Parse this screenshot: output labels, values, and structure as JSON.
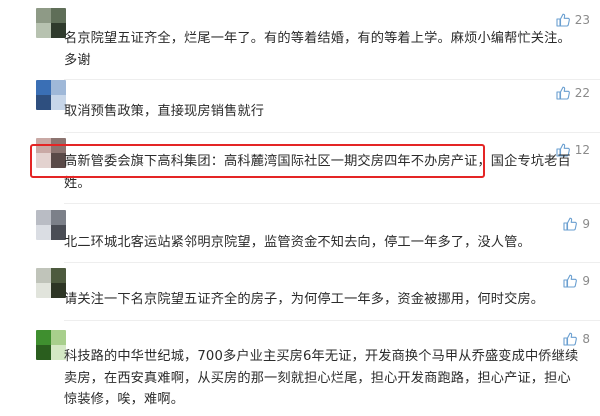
{
  "comments": [
    {
      "likes": "23",
      "text": "名京院望五证齐全，烂尾一年了。有的等着结婚，有的等着上学。麻烦小编帮忙关注。多谢",
      "avatar_colors": [
        "#8e9a86",
        "#5f6e58",
        "#b7c2b0",
        "#2f3a2c"
      ]
    },
    {
      "likes": "22",
      "text": "取消预售政策，直接现房销售就行",
      "avatar_colors": [
        "#3a6fb5",
        "#9fb8d8",
        "#2e4f7f",
        "#c7d6e9"
      ]
    },
    {
      "likes": "12",
      "text": "高新管委会旗下高科集团：高科麓湾国际社区一期交房四年不办房产证，国企专坑老百姓。",
      "avatar_colors": [
        "#c9a9a5",
        "#8c7470",
        "#e3d2cf",
        "#5a4a48"
      ]
    },
    {
      "likes": "9",
      "text": "北二环城北客运站紧邻明京院望，监管资金不知去向，停工一年多了，没人管。",
      "avatar_colors": [
        "#b9bcc4",
        "#7c8089",
        "#dadde3",
        "#4a4d55"
      ]
    },
    {
      "likes": "9",
      "text": "请关注一下名京院望五证齐全的房子，为何停工一年多，资金被挪用，何时交房。",
      "avatar_colors": [
        "#c0c4ba",
        "#4d5a3e",
        "#e1e4dc",
        "#2d3524"
      ]
    },
    {
      "likes": "8",
      "text": "科技路的中华世纪城，700多户业主买房6年无证，开发商换个马甲从乔盛变成中侨继续卖房，在西安真难啊，从买房的那一刻就担心烂尾，担心开发商跑路，担心产证，担心惊装修，唉，难啊。",
      "avatar_colors": [
        "#3f8f2f",
        "#a8cf8c",
        "#2a5e1e",
        "#d4e8c4"
      ]
    }
  ],
  "colors": {
    "highlight_border": "#e42525",
    "text": "#2b2b2b",
    "like": "#8a8a8a"
  }
}
